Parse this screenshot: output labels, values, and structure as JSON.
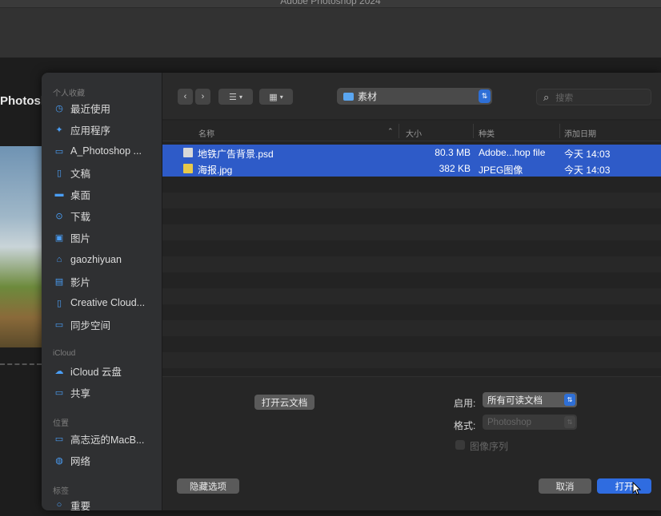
{
  "window": {
    "title": "Adobe Photoshop 2024"
  },
  "background": {
    "app_label": "Photosh"
  },
  "sidebar": {
    "sections": [
      {
        "label": "个人收藏",
        "items": [
          {
            "label": "最近使用",
            "icon": "clock-icon"
          },
          {
            "label": "应用程序",
            "icon": "applications-icon"
          },
          {
            "label": "A_Photoshop ...",
            "icon": "folder-icon"
          },
          {
            "label": "文稿",
            "icon": "document-icon"
          },
          {
            "label": "桌面",
            "icon": "desktop-icon"
          },
          {
            "label": "下载",
            "icon": "download-icon"
          },
          {
            "label": "图片",
            "icon": "photos-icon"
          },
          {
            "label": "gaozhiyuan",
            "icon": "home-icon"
          },
          {
            "label": "影片",
            "icon": "movies-icon"
          },
          {
            "label": "Creative Cloud...",
            "icon": "file-icon"
          },
          {
            "label": "同步空间",
            "icon": "folder-icon"
          }
        ]
      },
      {
        "label": "iCloud",
        "items": [
          {
            "label": "iCloud 云盘",
            "icon": "cloud-icon"
          },
          {
            "label": "共享",
            "icon": "shared-folder-icon"
          }
        ]
      },
      {
        "label": "位置",
        "items": [
          {
            "label": "高志远的MacB...",
            "icon": "laptop-icon"
          },
          {
            "label": "网络",
            "icon": "network-icon"
          }
        ]
      },
      {
        "label": "标签",
        "items": [
          {
            "label": "重要",
            "icon": "tag-icon"
          }
        ]
      }
    ]
  },
  "toolbar": {
    "back": "‹",
    "forward": "›",
    "current_folder": "素材",
    "search_placeholder": "搜索"
  },
  "columns": {
    "name": "名称",
    "size": "大小",
    "kind": "种类",
    "date_added": "添加日期"
  },
  "files": [
    {
      "name": "地铁广告背景.psd",
      "size": "80.3 MB",
      "kind": "Adobe...hop file",
      "date": "今天 14:03",
      "selected": true
    },
    {
      "name": "海报.jpg",
      "size": "382 KB",
      "kind": "JPEG图像",
      "date": "今天 14:03",
      "selected": true
    }
  ],
  "bottom": {
    "open_cloud_doc": "打开云文档",
    "enable_label": "启用:",
    "enable_value": "所有可读文档",
    "format_label": "格式:",
    "format_value": "Photoshop",
    "image_sequence": "图像序列",
    "hide_options": "隐藏选项",
    "cancel": "取消",
    "open": "打开"
  },
  "colors": {
    "accent": "#2e6fd6",
    "selection": "#2e5bc8"
  }
}
